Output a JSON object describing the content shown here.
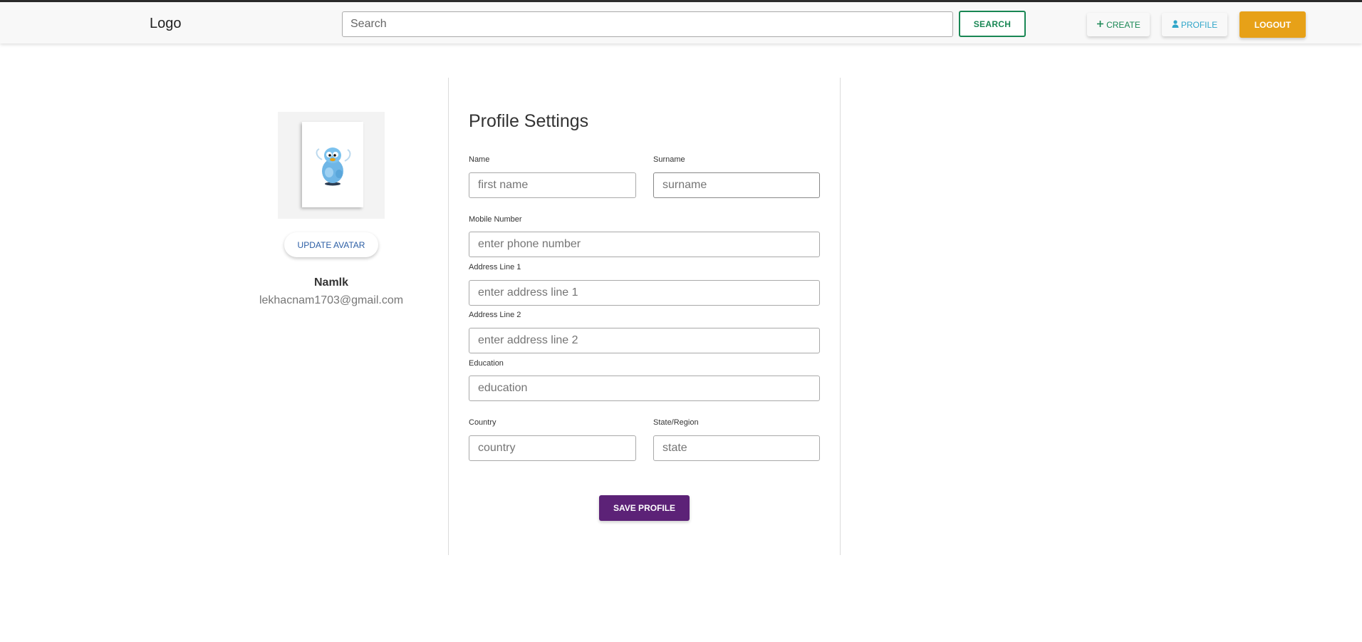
{
  "navbar": {
    "logo": "Logo",
    "search_placeholder": "Search",
    "search_button": "SEARCH",
    "create_button": "CREATE",
    "profile_button": "PROFILE",
    "logout_button": "LOGOUT",
    "create_icon": "plus-icon",
    "profile_icon": "person-icon"
  },
  "sidebar": {
    "avatar_icon": "penguin-avatar-image",
    "update_avatar_button": "UPDATE AVATAR",
    "user_name": "Namlk",
    "user_email": "lekhacnam1703@gmail.com"
  },
  "form": {
    "title": "Profile Settings",
    "name": {
      "label": "Name",
      "placeholder": "first name",
      "value": ""
    },
    "surname": {
      "label": "Surname",
      "placeholder": "surname",
      "value": ""
    },
    "mobile": {
      "label": "Mobile Number",
      "placeholder": "enter phone number",
      "value": ""
    },
    "address1": {
      "label": "Address Line 1",
      "placeholder": "enter address line 1",
      "value": ""
    },
    "address2": {
      "label": "Address Line 2",
      "placeholder": "enter address line 2",
      "value": ""
    },
    "education": {
      "label": "Education",
      "placeholder": "education",
      "value": ""
    },
    "country": {
      "label": "Country",
      "placeholder": "country",
      "value": ""
    },
    "state": {
      "label": "State/Region",
      "placeholder": "state",
      "value": ""
    },
    "save_button": "SAVE PROFILE"
  },
  "colors": {
    "search_green": "#198754",
    "profile_blue": "#31a6c9",
    "logout_orange": "#e7a118",
    "save_purple": "#5c2277",
    "avatar_link_blue": "#2b5ea5"
  }
}
